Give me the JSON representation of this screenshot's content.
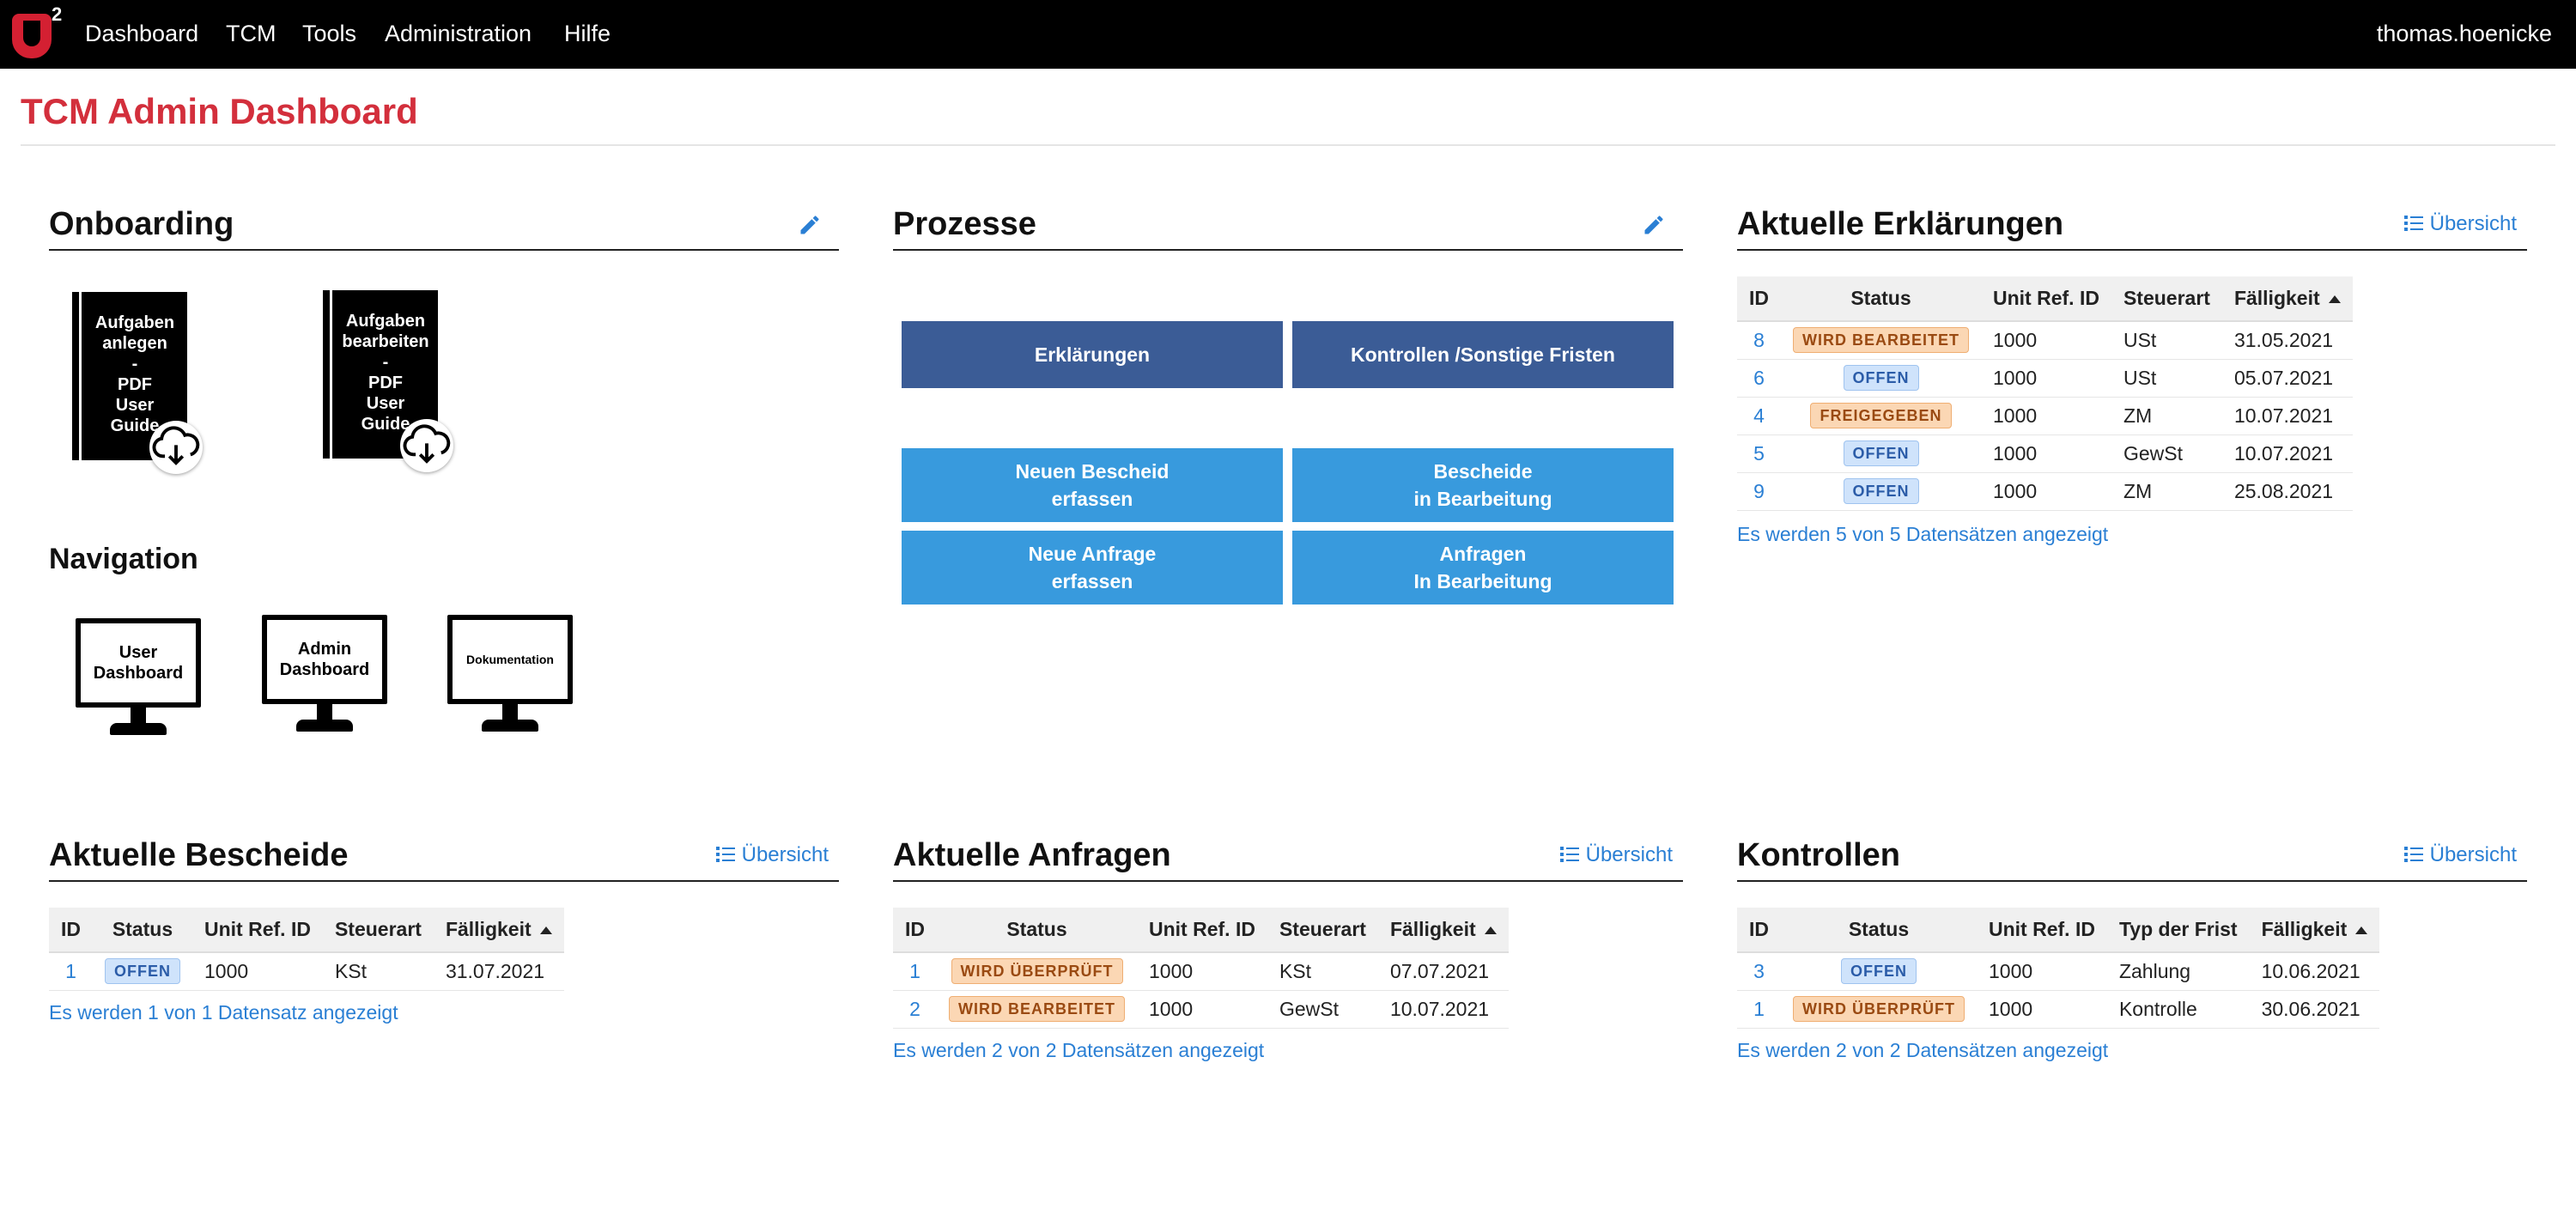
{
  "nav": {
    "logo_text": "U",
    "logo_sup": "2",
    "items": [
      "Dashboard",
      "TCM",
      "Tools",
      "Administration",
      "Hilfe"
    ],
    "user": "thomas.hoenicke"
  },
  "page": {
    "title": "TCM Admin Dashboard"
  },
  "onboarding": {
    "title": "Onboarding",
    "books": [
      {
        "lines": "Aufgaben\nanlegen\n-\nPDF\nUser\nGuide"
      },
      {
        "lines": "Aufgaben\nbearbeiten\n-\nPDF\nUser\nGuide"
      }
    ]
  },
  "navigation": {
    "title": "Navigation",
    "monitors": [
      "User\nDashboard",
      "Admin\nDashboard",
      "Dokumentation"
    ]
  },
  "prozesse": {
    "title": "Prozesse",
    "buttons": {
      "erklaerungen": "Erklärungen",
      "kontrollen": "Kontrollen /Sonstige Fristen",
      "neuer_bescheid": "Neuen Bescheid\nerfassen",
      "bescheide_bearbeitung": "Bescheide\nin Bearbeitung",
      "neue_anfrage": "Neue Anfrage\nerfassen",
      "anfragen_bearbeitung": "Anfragen\nIn Bearbeitung"
    }
  },
  "erklaerungen": {
    "title": "Aktuelle Erklärungen",
    "link": "Übersicht",
    "columns": [
      "ID",
      "Status",
      "Unit Ref. ID",
      "Steuerart",
      "Fälligkeit"
    ],
    "rows": [
      {
        "id": "8",
        "status": "WIRD BEARBEITET",
        "unit": "1000",
        "steuerart": "USt",
        "faelligkeit": "31.05.2021"
      },
      {
        "id": "6",
        "status": "OFFEN",
        "unit": "1000",
        "steuerart": "USt",
        "faelligkeit": "05.07.2021"
      },
      {
        "id": "4",
        "status": "FREIGEGEBEN",
        "unit": "1000",
        "steuerart": "ZM",
        "faelligkeit": "10.07.2021"
      },
      {
        "id": "5",
        "status": "OFFEN",
        "unit": "1000",
        "steuerart": "GewSt",
        "faelligkeit": "10.07.2021"
      },
      {
        "id": "9",
        "status": "OFFEN",
        "unit": "1000",
        "steuerart": "ZM",
        "faelligkeit": "25.08.2021"
      }
    ],
    "count": "Es werden 5 von 5 Datensätzen angezeigt"
  },
  "bescheide": {
    "title": "Aktuelle Bescheide",
    "link": "Übersicht",
    "columns": [
      "ID",
      "Status",
      "Unit Ref. ID",
      "Steuerart",
      "Fälligkeit"
    ],
    "rows": [
      {
        "id": "1",
        "status": "OFFEN",
        "unit": "1000",
        "steuerart": "KSt",
        "faelligkeit": "31.07.2021"
      }
    ],
    "count": "Es werden 1 von 1 Datensatz angezeigt"
  },
  "anfragen": {
    "title": "Aktuelle Anfragen",
    "link": "Übersicht",
    "columns": [
      "ID",
      "Status",
      "Unit Ref. ID",
      "Steuerart",
      "Fälligkeit"
    ],
    "rows": [
      {
        "id": "1",
        "status": "WIRD ÜBERPRÜFT",
        "unit": "1000",
        "steuerart": "KSt",
        "faelligkeit": "07.07.2021"
      },
      {
        "id": "2",
        "status": "WIRD BEARBEITET",
        "unit": "1000",
        "steuerart": "GewSt",
        "faelligkeit": "10.07.2021"
      }
    ],
    "count": "Es werden 2 von 2 Datensätzen angezeigt"
  },
  "kontrollen": {
    "title": "Kontrollen",
    "link": "Übersicht",
    "columns": [
      "ID",
      "Status",
      "Unit Ref. ID",
      "Typ der Frist",
      "Fälligkeit"
    ],
    "rows": [
      {
        "id": "3",
        "status": "OFFEN",
        "unit": "1000",
        "typ": "Zahlung",
        "faelligkeit": "10.06.2021"
      },
      {
        "id": "1",
        "status": "WIRD ÜBERPRÜFT",
        "unit": "1000",
        "typ": "Kontrolle",
        "faelligkeit": "30.06.2021"
      }
    ],
    "count": "Es werden 2 von 2 Datensätzen angezeigt"
  },
  "colors": {
    "brand_red": "#d32f3c",
    "link_blue": "#2a7fd4",
    "button_dark": "#3b5c96",
    "button_light": "#389add",
    "badge_offen_bg": "#cfe3fb",
    "badge_orange_bg": "#fbd7b4"
  }
}
